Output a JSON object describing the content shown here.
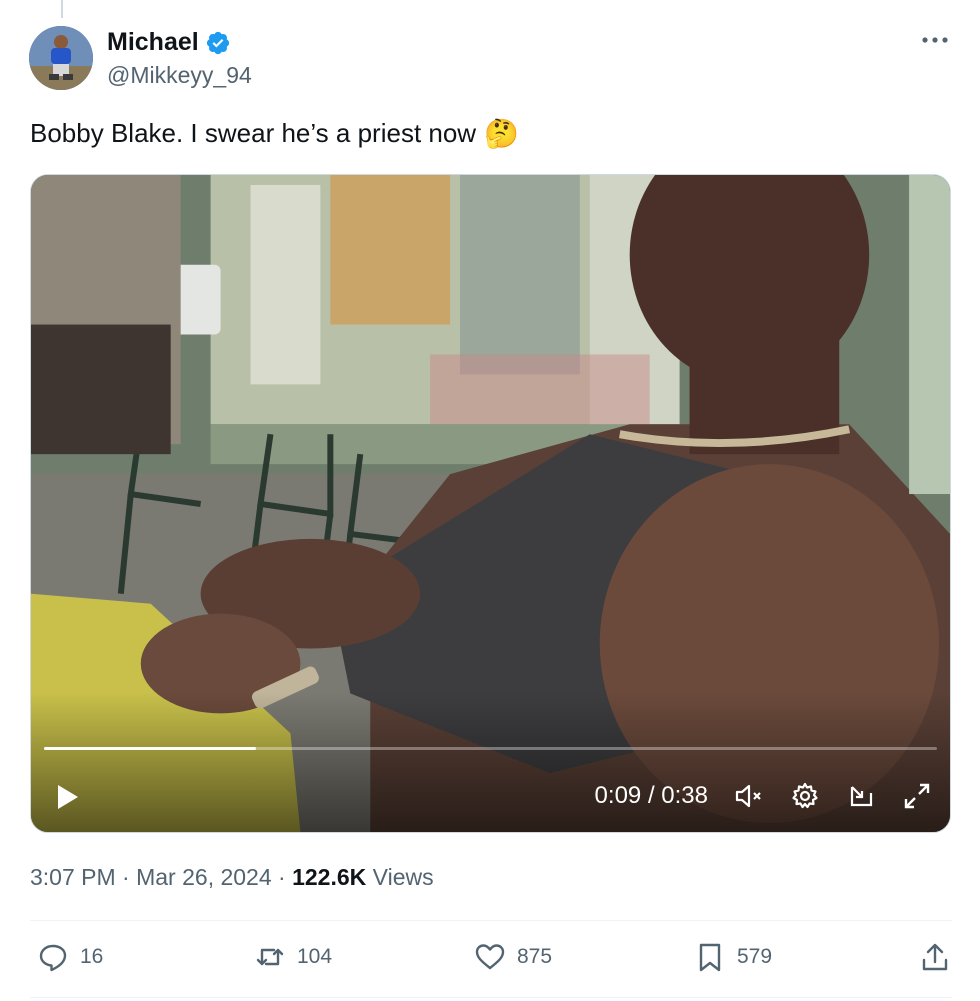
{
  "author": {
    "display_name": "Michael",
    "handle": "@Mikkeyy_94"
  },
  "tweet": {
    "text": "Bobby Blake. I swear he’s a priest now",
    "emoji": "🤔"
  },
  "video": {
    "current_time": "0:09",
    "separator": "/",
    "duration": "0:38",
    "progress_fraction": 0.237
  },
  "meta": {
    "time": "3:07 PM",
    "dot1": "·",
    "date": "Mar 26, 2024",
    "dot2": "·",
    "views_count": "122.6K",
    "views_label": "Views"
  },
  "actions": {
    "replies": "16",
    "reposts": "104",
    "likes": "875",
    "bookmarks": "579"
  },
  "icons": {
    "verified": "verified-badge-icon",
    "more": "more-icon",
    "play": "play-icon",
    "mute": "volume-muted-icon",
    "settings": "gear-icon",
    "pip": "picture-in-picture-icon",
    "fullscreen": "fullscreen-icon",
    "reply": "reply-icon",
    "repost": "repost-icon",
    "like": "heart-icon",
    "bookmark": "bookmark-icon",
    "share": "share-icon"
  },
  "colors": {
    "verified_blue": "#1d9bf0",
    "text_primary": "#0f1419",
    "text_secondary": "#536471"
  }
}
